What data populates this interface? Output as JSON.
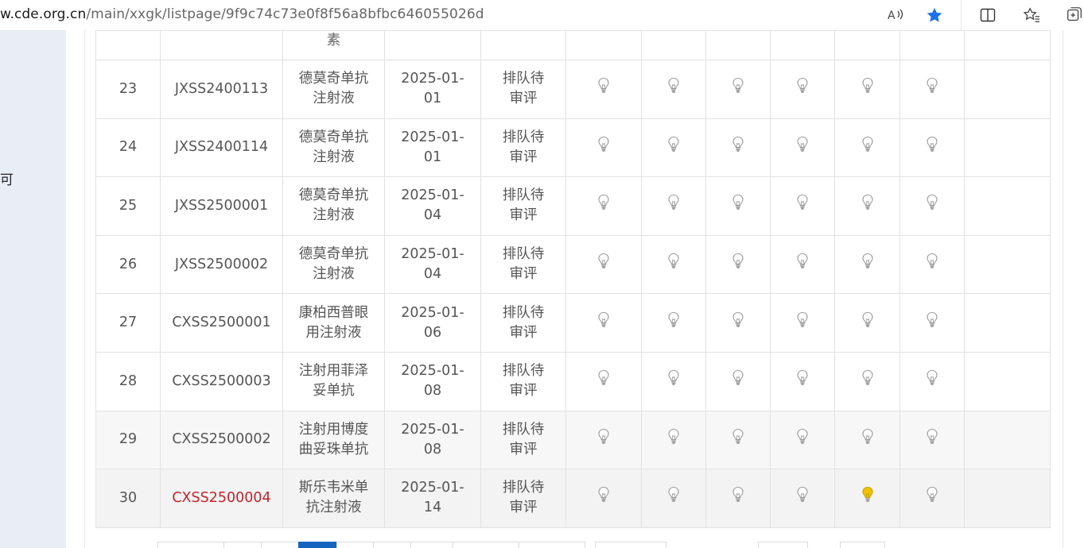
{
  "browser": {
    "url_host": "w.cde.org.cn",
    "url_path": "/main/xxgk/listpage/9f9c74c73e0f8f56a8bfbc646055026d"
  },
  "sidebar": {
    "fragment": "可"
  },
  "table": {
    "partial_top": {
      "name_fragment": "素"
    },
    "rows": [
      {
        "no": "23",
        "code": "JXSS2400113",
        "name": "德莫奇单抗注射液",
        "date": "2025-01-01",
        "status": "排队待审评",
        "bulbs": [
          "off",
          "off",
          "off",
          "off",
          "off",
          "off"
        ]
      },
      {
        "no": "24",
        "code": "JXSS2400114",
        "name": "德莫奇单抗注射液",
        "date": "2025-01-01",
        "status": "排队待审评",
        "bulbs": [
          "off",
          "off",
          "off",
          "off",
          "off",
          "off"
        ]
      },
      {
        "no": "25",
        "code": "JXSS2500001",
        "name": "德莫奇单抗注射液",
        "date": "2025-01-04",
        "status": "排队待审评",
        "bulbs": [
          "off",
          "off",
          "off",
          "off",
          "off",
          "off"
        ]
      },
      {
        "no": "26",
        "code": "JXSS2500002",
        "name": "德莫奇单抗注射液",
        "date": "2025-01-04",
        "status": "排队待审评",
        "bulbs": [
          "off",
          "off",
          "off",
          "off",
          "off",
          "off"
        ]
      },
      {
        "no": "27",
        "code": "CXSS2500001",
        "name": "康柏西普眼用注射液",
        "date": "2025-01-06",
        "status": "排队待审评",
        "bulbs": [
          "off",
          "off",
          "off",
          "off",
          "off",
          "off"
        ]
      },
      {
        "no": "28",
        "code": "CXSS2500003",
        "name": "注射用菲泽妥单抗",
        "date": "2025-01-08",
        "status": "排队待审评",
        "bulbs": [
          "off",
          "off",
          "off",
          "off",
          "off",
          "off"
        ]
      },
      {
        "no": "29",
        "code": "CXSS2500002",
        "name": "注射用博度曲妥珠单抗",
        "date": "2025-01-08",
        "status": "排队待审评",
        "bulbs": [
          "off",
          "off",
          "off",
          "off",
          "off",
          "off"
        ]
      },
      {
        "no": "30",
        "code": "CXSS2500004",
        "name": "斯乐韦米单抗注射液",
        "date": "2025-01-14",
        "status": "排队待审评",
        "bulbs": [
          "off",
          "off",
          "off",
          "off",
          "on",
          "off"
        ],
        "highlight": true
      }
    ]
  },
  "colors": {
    "highlight_code": "#c8202a",
    "bulb_on": "#f2c200",
    "pager_active": "#1565c0"
  },
  "icons": {
    "read_aloud": "read-aloud-icon",
    "favorite": "star-filled-icon",
    "split_screen": "split-screen-icon",
    "favorites_list": "favorites-icon",
    "collections": "collections-icon",
    "bulb": "lightbulb-icon"
  }
}
